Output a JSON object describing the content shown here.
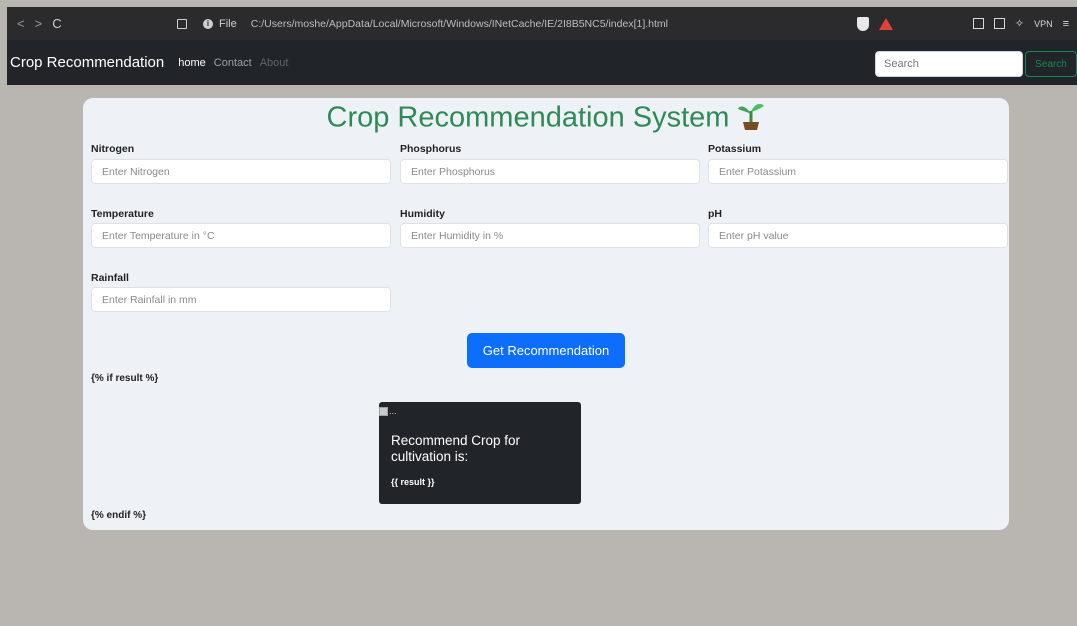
{
  "browser": {
    "back": "<",
    "forward": ">",
    "reload": "C",
    "file_label": "File",
    "url": "C:/Users/moshe/AppData/Local/Microsoft/Windows/INetCache/IE/2I8B5NC5/index[1].html",
    "vpn_label": "VPN"
  },
  "navbar": {
    "brand": "Crop Recommendation",
    "links": [
      "home",
      "Contact",
      "About"
    ],
    "search_placeholder": "Search",
    "search_button": "Search"
  },
  "form": {
    "title": "Crop Recommendation System",
    "fields": [
      {
        "label": "Nitrogen",
        "placeholder": "Enter Nitrogen"
      },
      {
        "label": "Phosphorus",
        "placeholder": "Enter Phosphorus"
      },
      {
        "label": "Potassium",
        "placeholder": "Enter Potassium"
      },
      {
        "label": "Temperature",
        "placeholder": "Enter Temperature in °C"
      },
      {
        "label": "Humidity",
        "placeholder": "Enter Humidity in %"
      },
      {
        "label": "pH",
        "placeholder": "Enter pH value"
      },
      {
        "label": "Rainfall",
        "placeholder": "Enter Rainfall in mm"
      }
    ],
    "submit_label": "Get Recommendation"
  },
  "template": {
    "if_tag": "{% if result %}",
    "endif_tag": "{% endif %}"
  },
  "result": {
    "img_alt": "...",
    "title": "Recommend Crop for cultivation is:",
    "value": "{{ result }}"
  },
  "colors": {
    "title_green": "#2e8b57",
    "primary_button": "#0d6efd",
    "navbar_bg": "#212529"
  }
}
